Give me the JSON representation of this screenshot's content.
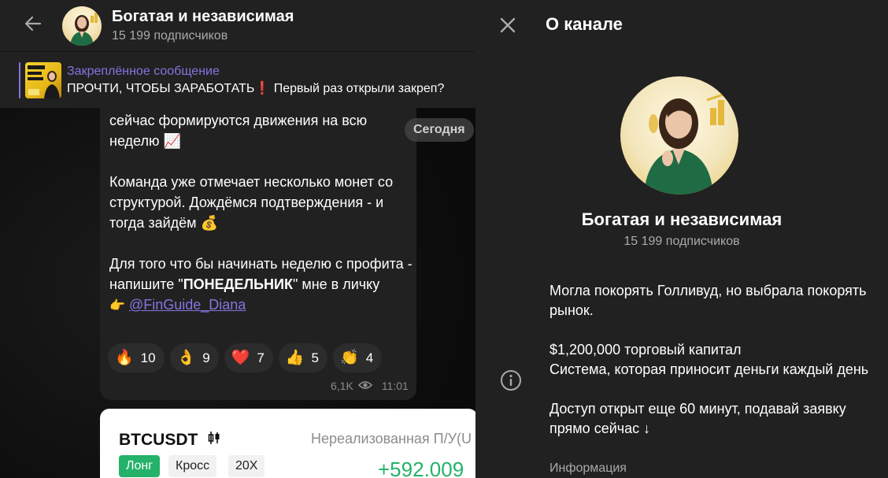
{
  "chat": {
    "header": {
      "title": "Богатая и независимая",
      "subscribers": "15 199 подписчиков"
    },
    "pinned": {
      "title": "Закреплённое сообщение",
      "text": "ПРОЧТИ, ЧТОБЫ ЗАРАБОТАТЬ❗ Первый раз открыли закреп?"
    },
    "date_pill": "Сегодня",
    "message": {
      "line1": "сейчас формируются движения на всю",
      "line2": "неделю 📈",
      "para2": "Команда уже отмечает несколько монет со структурой. Дождёмся подтверждения - и тогда зайдём 💰",
      "para3_prefix": "Для того что бы начинать неделю с профита - напишите \"",
      "para3_bold": "ПОНЕДЕЛЬНИК",
      "para3_suffix": "\" мне в личку",
      "mention_emoji": "👉",
      "mention": "@FinGuide_Diana",
      "views": "6,1K",
      "time": "11:01"
    },
    "reactions": [
      {
        "emoji": "🔥",
        "count": "10"
      },
      {
        "emoji": "👌",
        "count": "9"
      },
      {
        "emoji": "❤️",
        "count": "7"
      },
      {
        "emoji": "👍",
        "count": "5"
      },
      {
        "emoji": "👏",
        "count": "4"
      }
    ],
    "trade_card": {
      "symbol": "BTCUSDT",
      "unrealized_label": "Нереализованная П/У(U",
      "tag_long": "Лонг",
      "tag_cross": "Кросс",
      "tag_leverage": "20X",
      "profit": "+592.009"
    }
  },
  "info_panel": {
    "title": "О канале",
    "channel_name": "Богатая и независимая",
    "subscribers": "15 199 подписчиков",
    "description": {
      "p1": "Могла покорять Голливуд, но выбрала покорять рынок.",
      "p2_line1": "$1,200,000 торговый капитал",
      "p2_line2": "Система, которая приносит деньги каждый день",
      "p3": "Доступ открыт еще 60 минут, подавай заявку прямо сейчас ↓"
    },
    "description_label": "Информация"
  },
  "colors": {
    "accent": "#8774e1",
    "panel_bg": "#212121",
    "profit_green": "#24b26a"
  },
  "icons": {
    "back": "arrow-left-icon",
    "close": "close-icon",
    "info": "info-circle-icon",
    "views": "eye-icon",
    "trade_pair": "candlestick-icon"
  }
}
